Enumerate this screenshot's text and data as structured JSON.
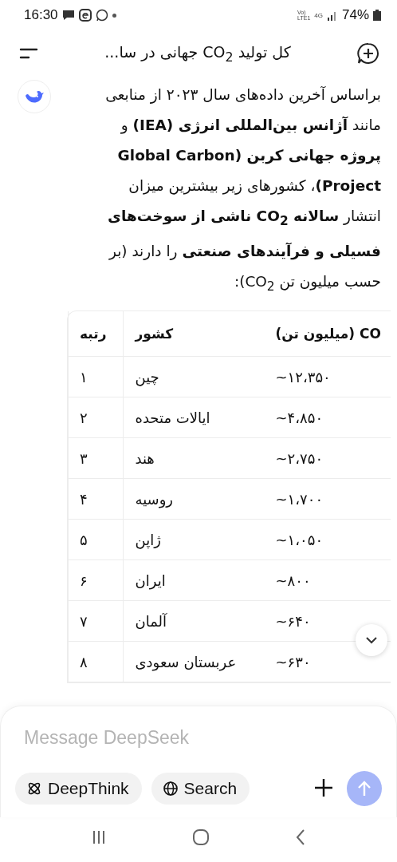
{
  "status_bar": {
    "time": "16:30",
    "volte": "Vo)",
    "lte": "LTE1",
    "network": "4G",
    "battery": "74%"
  },
  "header": {
    "title": "کل تولید CO$_{2}$ جهانی در سا..."
  },
  "message": {
    "text": "براساس آخرین داده‌های سال ۲۰۲۳ از منابعی مانند **آژانس بین‌المللی انرژی (IEA)** و **پروژه جهانی کربن (Global Carbon Project)**، کشورهای زیر بیشترین میزان انتشار **سالانه CO$_{2}$ ناشی از سوخت‌های فسیلی و فرآیندهای صنعتی** را دارند (بر حسب میلیون تن CO$_{2}$):"
  },
  "table": {
    "columns": [
      "CO (میلیون تن)",
      "کشور",
      "رتبه"
    ],
    "rows": [
      [
        "~۱۲،۳۵۰",
        "چین",
        "۱"
      ],
      [
        "~۴،۸۵۰",
        "ایالات متحده",
        "۲"
      ],
      [
        "~۲،۷۵۰",
        "هند",
        "۳"
      ],
      [
        "~۱،۷۰۰",
        "روسیه",
        "۴"
      ],
      [
        "~۱،۰۵۰",
        "ژاپن",
        "۵"
      ],
      [
        "~۸۰۰",
        "ایران",
        "۶"
      ],
      [
        "~۶۴۰",
        "آلمان",
        "۷"
      ],
      [
        "~۶۳۰",
        "عربستان سعودی",
        "۸"
      ]
    ]
  },
  "composer": {
    "placeholder": "Message DeepSeek",
    "toggles": [
      {
        "kind": "search",
        "label": "Search",
        "selected": false
      },
      {
        "kind": "deepthink",
        "label": "DeepThink",
        "selected": false
      }
    ],
    "send_disabled": true
  }
}
